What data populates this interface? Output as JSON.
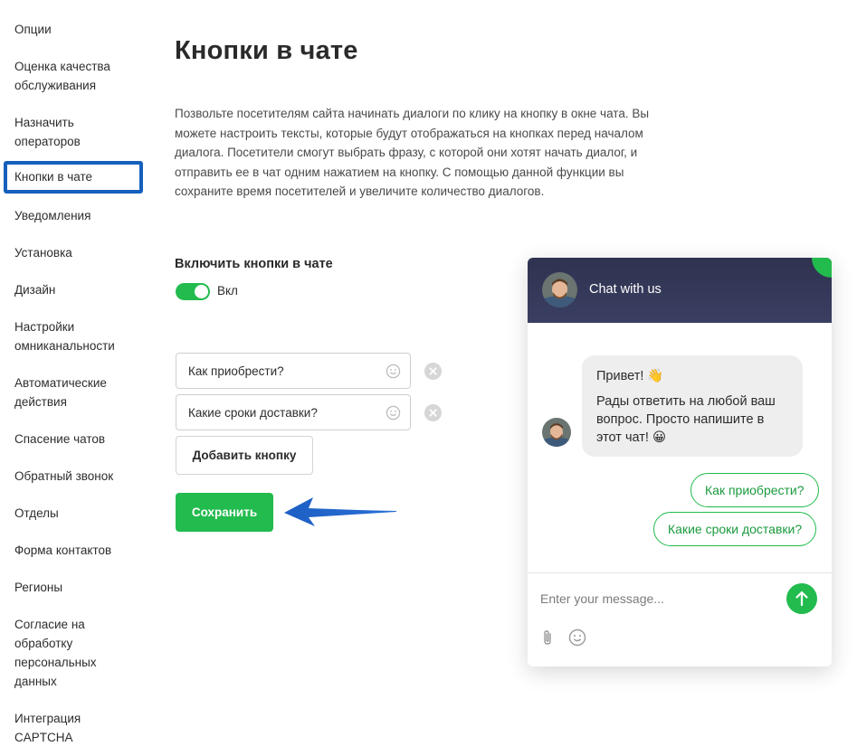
{
  "sidebar": {
    "items": [
      {
        "label": "Опции"
      },
      {
        "label": "Оценка качества обслуживания"
      },
      {
        "label": "Назначить операторов"
      },
      {
        "label": "Кнопки в чате"
      },
      {
        "label": "Уведомления"
      },
      {
        "label": "Установка"
      },
      {
        "label": "Дизайн"
      },
      {
        "label": "Настройки омниканальности"
      },
      {
        "label": "Автоматические действия"
      },
      {
        "label": "Спасение чатов"
      },
      {
        "label": "Обратный звонок"
      },
      {
        "label": "Отделы"
      },
      {
        "label": "Форма контактов"
      },
      {
        "label": "Регионы"
      },
      {
        "label": "Согласие на обработку персональных данных"
      },
      {
        "label": "Интеграция CAPTCHA"
      }
    ],
    "active_index": 3
  },
  "main": {
    "title": "Кнопки в чате",
    "description": "Позвольте посетителям сайта начинать диалоги по клику на кнопку в окне чата. Вы можете настроить тексты, которые будут отображаться на кнопках перед началом диалога. Посетители смогут выбрать фразу, с которой они хотят начать диалог, и отправить ее в чат одним нажатием на кнопку. С помощью данной функции вы сохраните время посетителей и увеличите количество диалогов.",
    "toggle_label": "Включить кнопки в чате",
    "toggle_state": "Вкл",
    "toggle_on": true,
    "buttons": [
      {
        "value": "Как приобрести?"
      },
      {
        "value": "Какие сроки доставки?"
      }
    ],
    "add_button_label": "Добавить кнопку",
    "save_label": "Сохранить"
  },
  "chat": {
    "header_title": "Chat with us",
    "greeting": "Привет! 👋",
    "message": "Рады ответить на любой ваш вопрос. Просто напишите в этот чат! 😀",
    "quick_replies": [
      "Как приобрести?",
      "Какие сроки доставки?"
    ],
    "input_placeholder": "Enter your message...",
    "icons": [
      "paperclip-icon",
      "smile-icon",
      "send-arrow-icon"
    ]
  },
  "colors": {
    "accent_green": "#22bb4e",
    "active_border": "#1560bd",
    "arrow_blue": "#1d5fc4",
    "chat_header": "#353958"
  }
}
